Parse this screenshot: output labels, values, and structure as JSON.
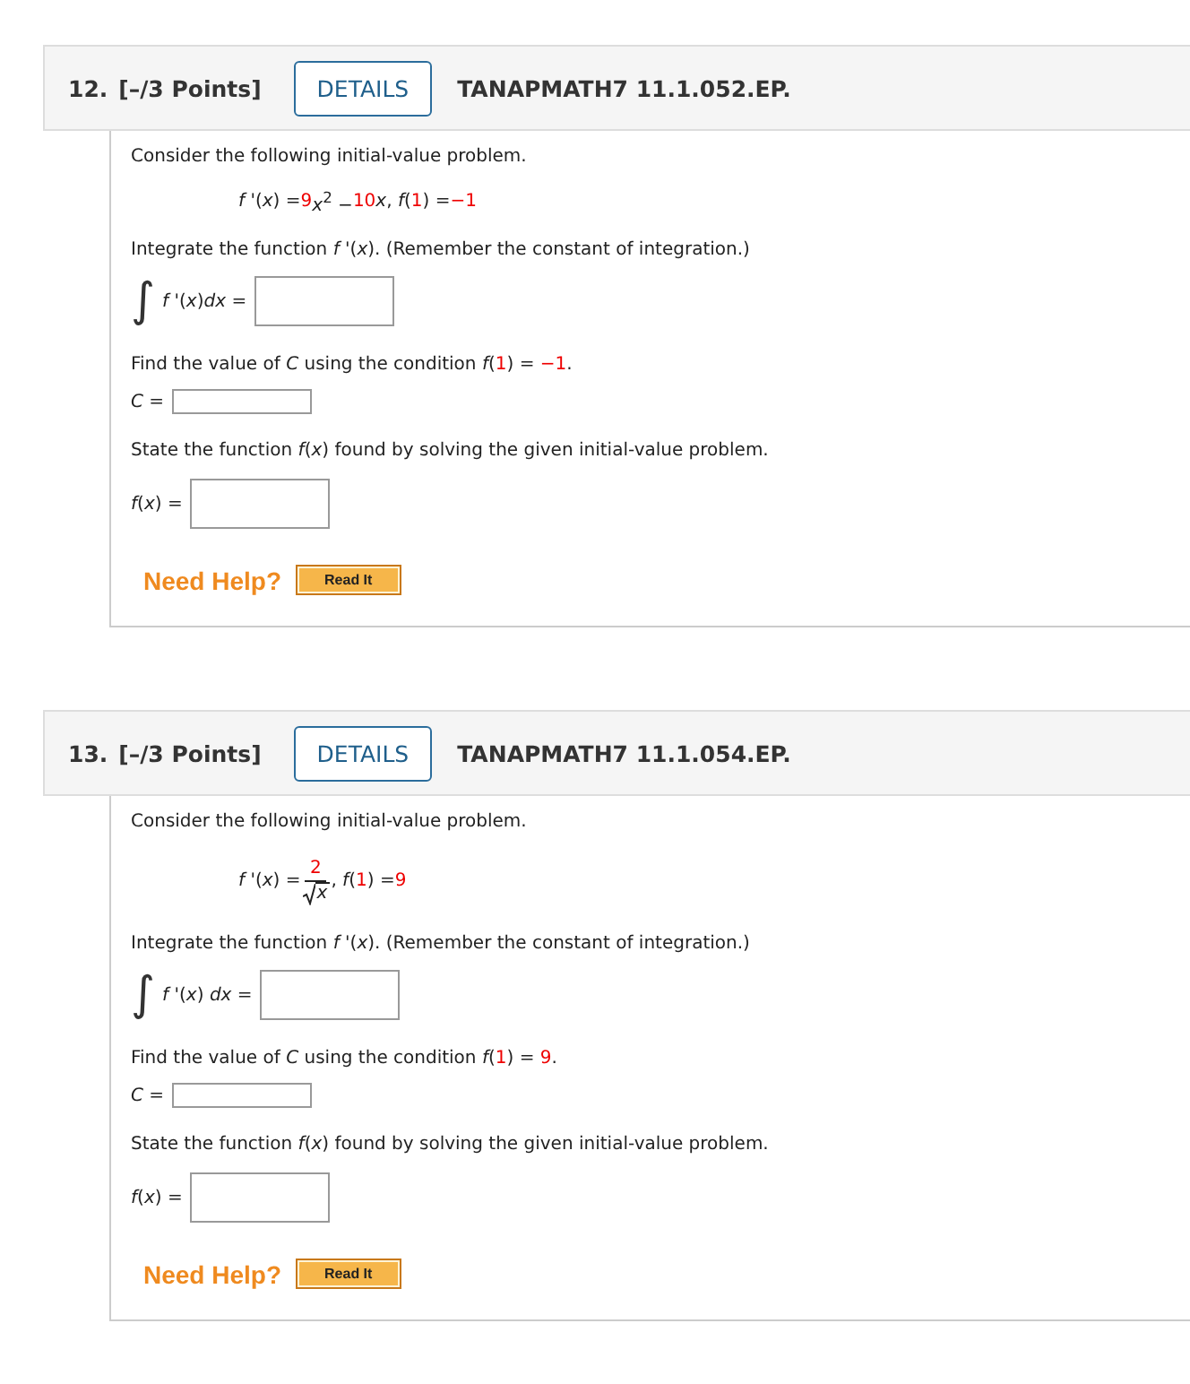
{
  "problems": [
    {
      "number": "12.",
      "points": "[–/3 Points]",
      "details": "DETAILS",
      "code": "TANAPMATH7 11.1.052.EP.",
      "intro": "Consider the following initial-value problem.",
      "equation": [
        {
          "kind": "text",
          "text": "*f* '(*x*) = ",
          "highlight": false
        },
        {
          "kind": "text",
          "text": "9",
          "highlight": true
        },
        {
          "kind": "text",
          "text": "*x*$^{2}$ − ",
          "highlight": false
        },
        {
          "kind": "text",
          "text": "10",
          "highlight": true
        },
        {
          "kind": "text",
          "text": "*x*, *f*(",
          "highlight": false
        },
        {
          "kind": "text",
          "text": "1",
          "highlight": true
        },
        {
          "kind": "text",
          "text": ") = ",
          "highlight": false
        },
        {
          "kind": "text",
          "text": "−1",
          "highlight": true
        }
      ],
      "integrate_prompt": "Integrate the function *f* '(*x*). (Remember the constant of integration.)",
      "integral_sign": "∫",
      "integral_label": "*f* '(*x*)*dx* =",
      "c_prompt": [
        {
          "kind": "text",
          "text": "Find the value of *C* using the condition *f*(",
          "highlight": false
        },
        {
          "kind": "text",
          "text": "1",
          "highlight": true
        },
        {
          "kind": "text",
          "text": ") = ",
          "highlight": false
        },
        {
          "kind": "text",
          "text": "−1",
          "highlight": true
        },
        {
          "kind": "text",
          "text": ".",
          "highlight": false
        }
      ],
      "c_label": "*C* =",
      "state_prompt": "State the function *f*(*x*) found by solving the given initial-value problem.",
      "f_label": "*f*(*x*) =",
      "help": "Need Help?",
      "read_it": "Read It"
    },
    {
      "number": "13.",
      "points": "[–/3 Points]",
      "details": "DETAILS",
      "code": "TANAPMATH7 11.1.054.EP.",
      "intro": "Consider the following initial-value problem.",
      "equation": [
        {
          "kind": "text",
          "text": "*f* '(*x*) = ",
          "highlight": false
        },
        {
          "kind": "sqrt_fraction",
          "numerator": "2",
          "radicand": "x",
          "highlight": true
        },
        {
          "kind": "text",
          "text": ", *f*(",
          "highlight": false
        },
        {
          "kind": "text",
          "text": "1",
          "highlight": true
        },
        {
          "kind": "text",
          "text": ") = ",
          "highlight": false
        },
        {
          "kind": "text",
          "text": "9",
          "highlight": true
        }
      ],
      "integrate_prompt": "Integrate the function *f* '(*x*). (Remember the constant of integration.)",
      "integral_sign": "∫",
      "integral_label": "*f* '(*x*) *dx* =",
      "c_prompt": [
        {
          "kind": "text",
          "text": "Find the value of *C* using the condition *f*(",
          "highlight": false
        },
        {
          "kind": "text",
          "text": "1",
          "highlight": true
        },
        {
          "kind": "text",
          "text": ") = ",
          "highlight": false
        },
        {
          "kind": "text",
          "text": "9",
          "highlight": true
        },
        {
          "kind": "text",
          "text": ".",
          "highlight": false
        }
      ],
      "c_label": "*C* =",
      "state_prompt": "State the function *f*(*x*) found by solving the given initial-value problem.",
      "f_label": "*f*(*x*) =",
      "help": "Need Help?",
      "read_it": "Read It"
    }
  ]
}
